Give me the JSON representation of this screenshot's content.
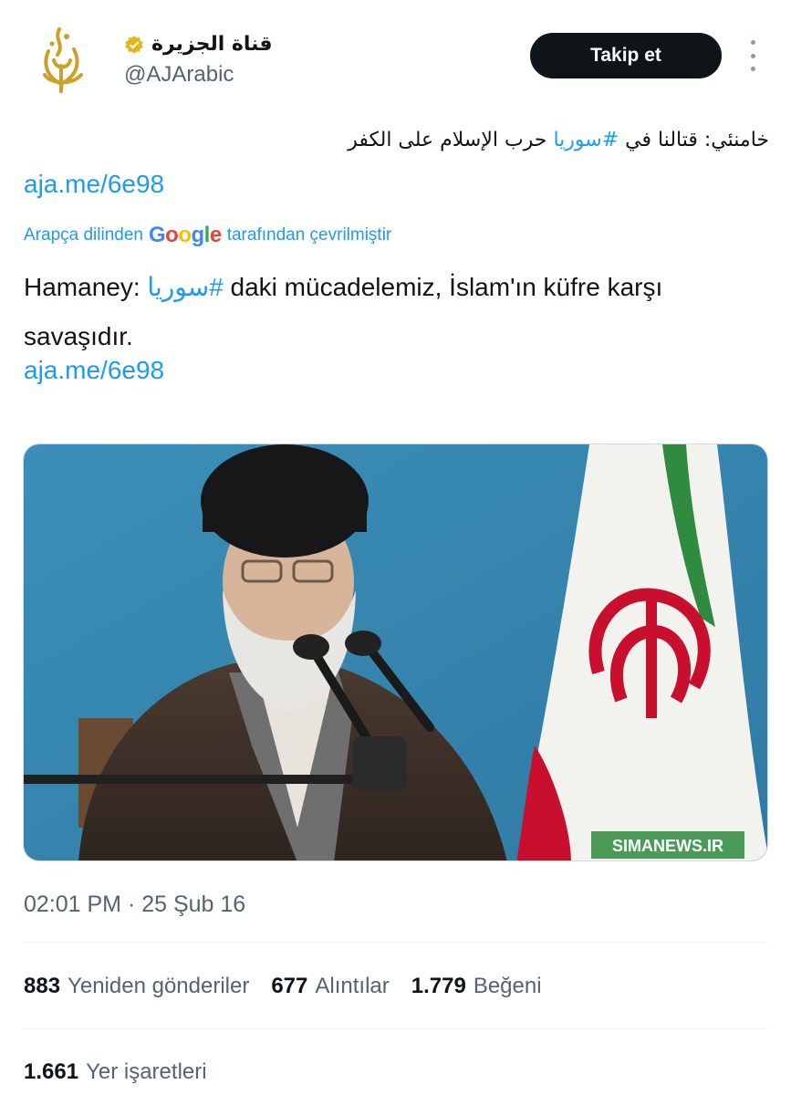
{
  "account": {
    "display_name": "قناة الجزيرة",
    "handle": "@AJArabic",
    "verified_icon": "verified-badge-gold",
    "avatar_icon": "al-jazeera-logo"
  },
  "follow_button": {
    "label": "Takip et"
  },
  "more_icon": "more-vertical-icon",
  "tweet": {
    "original_before": "خامنئي: قتالنا في ",
    "original_hashtag": "#سوريا",
    "original_after": " حرب الإسلام على الكفر",
    "link1": "aja.me/6e98",
    "translation_prefix": "Arapça dilinden",
    "translation_brand": "Google",
    "translation_suffix": "tarafından çevrilmiştir",
    "translated_before": "Hamaney: ",
    "translated_hashtag": "#سوريا",
    "translated_after": "daki mücadelemiz, İslam'ın küfre karşı savaşıdır.",
    "link2": "aja.me/6e98"
  },
  "media": {
    "watermark": "SIMANEWS.IR"
  },
  "timestamp": "02:01 PM · 25 Şub 16",
  "stats": [
    {
      "count": "883",
      "label": "Yeniden gönderiler"
    },
    {
      "count": "677",
      "label": "Alıntılar"
    },
    {
      "count": "1.779",
      "label": "Beğeni"
    }
  ],
  "bookmarks": {
    "count": "1.661",
    "label": "Yer işaretleri"
  },
  "colors": {
    "link": "#1d9bf0",
    "text": "#0f1419",
    "secondary": "#536471",
    "button_bg": "#0f1419",
    "verified": "#e2b719"
  }
}
